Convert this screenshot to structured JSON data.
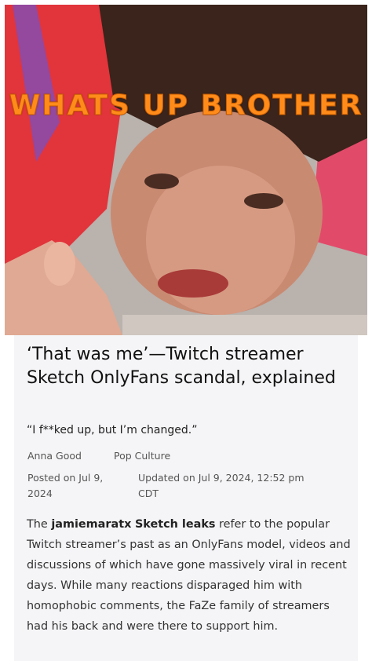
{
  "hero": {
    "caption": "WHATS UP BROTHER"
  },
  "article": {
    "headline": "‘That was me’—Twitch streamer Sketch OnlyFans scandal, explained",
    "subhead": "“I f**ked up, but I’m changed.”",
    "author": "Anna Good",
    "category": "Pop Culture",
    "posted": "Posted on Jul 9, 2024",
    "updated": "Updated on Jul 9, 2024, 12:52 pm CDT",
    "body": {
      "prefix": "The ",
      "bold1": "jamiemaratx",
      "space": " ",
      "bold2": "Sketch leaks",
      "rest": " refer to the popular Twitch streamer’s past as an OnlyFans model, videos and discussions of which have gone massively viral in recent days. While many reactions disparaged him with homophobic comments, the FaZe family of streamers had his back and were there to support him."
    }
  }
}
